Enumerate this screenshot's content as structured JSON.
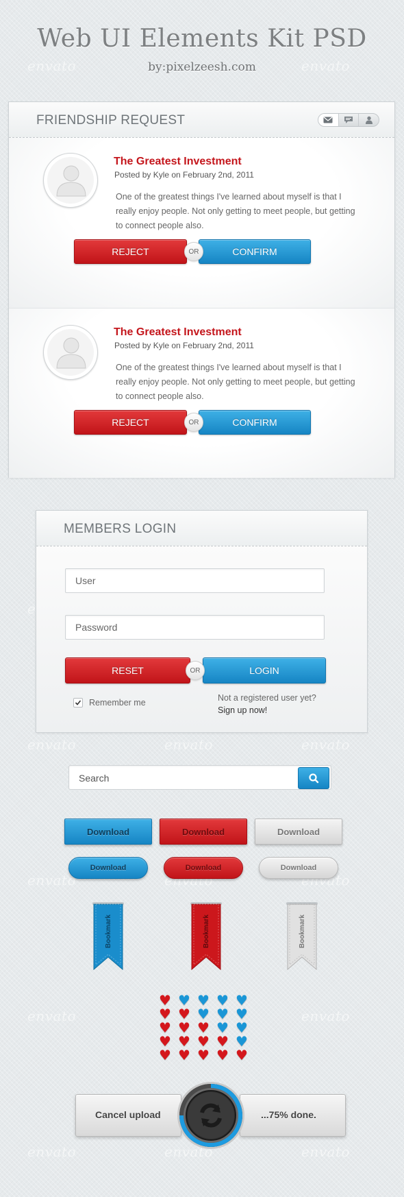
{
  "header": {
    "title": "Web UI Elements Kit PSD",
    "subtitle": "by:pixelzeesh.com"
  },
  "watermark": "envato",
  "friendship": {
    "title": "FRIENDSHIP REQUEST",
    "header_icons": [
      "mail-icon",
      "chat-icon",
      "user-icon"
    ],
    "items": [
      {
        "heading": "The Greatest Investment",
        "meta": "Posted by Kyle on February 2nd, 2011",
        "body": "One of the greatest things I've learned about myself is that I really enjoy people. Not only getting to meet people, but getting to connect people also.",
        "reject": "REJECT",
        "or": "OR",
        "confirm": "CONFIRM"
      },
      {
        "heading": "The Greatest Investment",
        "meta": "Posted by Kyle on February 2nd, 2011",
        "body": "One of the greatest things I've learned about myself is that I really enjoy people. Not only getting to meet people, but getting to connect people also.",
        "reject": "REJECT",
        "or": "OR",
        "confirm": "CONFIRM"
      }
    ]
  },
  "login": {
    "title": "MEMBERS LOGIN",
    "user_placeholder": "User",
    "password_placeholder": "Password",
    "reset": "RESET",
    "or": "OR",
    "login": "LOGIN",
    "remember": "Remember me",
    "remember_checked": true,
    "not_registered": "Not a registered user yet?",
    "signup": "Sign up now!"
  },
  "search": {
    "placeholder": "Search",
    "icon": "search-icon"
  },
  "downloads": {
    "label": "Download",
    "colors": [
      "#1685c4",
      "#c11419",
      "#d6d6d6"
    ]
  },
  "bookmarks": {
    "label": "Bookmark"
  },
  "hearts": {
    "rows": [
      [
        "red",
        "blue",
        "blue",
        "blue",
        "blue"
      ],
      [
        "red",
        "red",
        "blue",
        "blue",
        "blue"
      ],
      [
        "red",
        "red",
        "red",
        "blue",
        "blue"
      ],
      [
        "red",
        "red",
        "red",
        "red",
        "blue"
      ],
      [
        "red",
        "red",
        "red",
        "red",
        "red"
      ]
    ],
    "red": "#d4171c",
    "blue": "#1a96d6"
  },
  "upload": {
    "cancel": "Cancel upload",
    "status": "...75% done.",
    "progress": 0.75,
    "icon": "refresh-icon"
  }
}
